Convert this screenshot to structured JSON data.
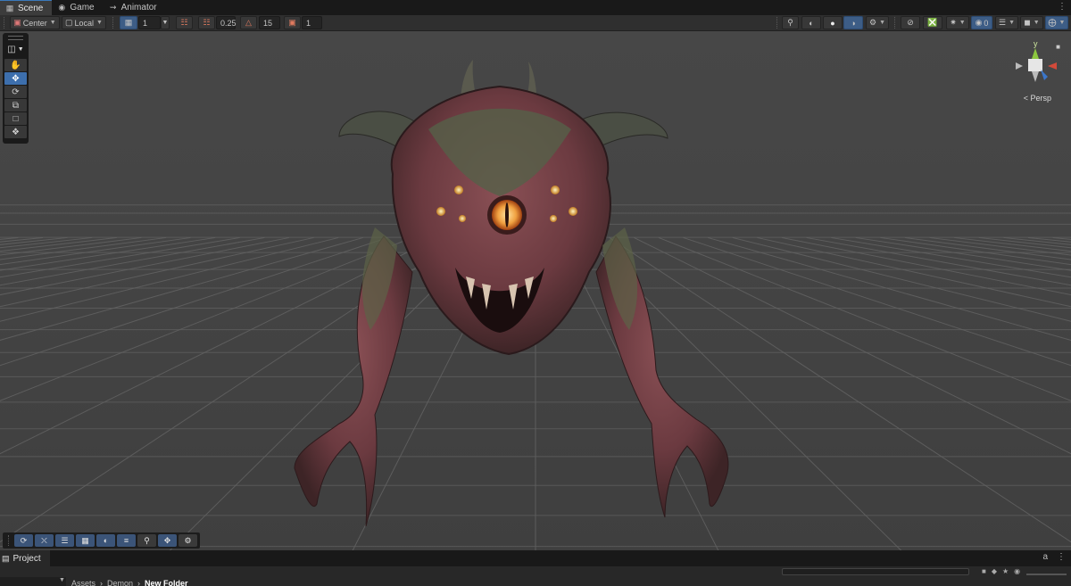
{
  "tabs": [
    {
      "label": "Scene",
      "icon": "grid-icon",
      "active": true
    },
    {
      "label": "Game",
      "icon": "gamepad-icon",
      "active": false
    },
    {
      "label": "Animator",
      "icon": "animator-icon",
      "active": false
    }
  ],
  "toolbar": {
    "pivot_label": "Center",
    "space_label": "Local",
    "grid_size": "1",
    "snap_increment": "0.25",
    "rotate_snap": "15",
    "scale_snap": "1"
  },
  "gizmo": {
    "view_label": "Persp",
    "y_axis": "y"
  },
  "visibility": {
    "hidden_count": "0"
  },
  "project": {
    "tab_label": "Project",
    "breadcrumbs": [
      "Assets",
      "Demon",
      "New Folder"
    ]
  },
  "colors": {
    "accent": "#3d6fad",
    "panel_dark": "#191919",
    "viewport": "#444444"
  }
}
